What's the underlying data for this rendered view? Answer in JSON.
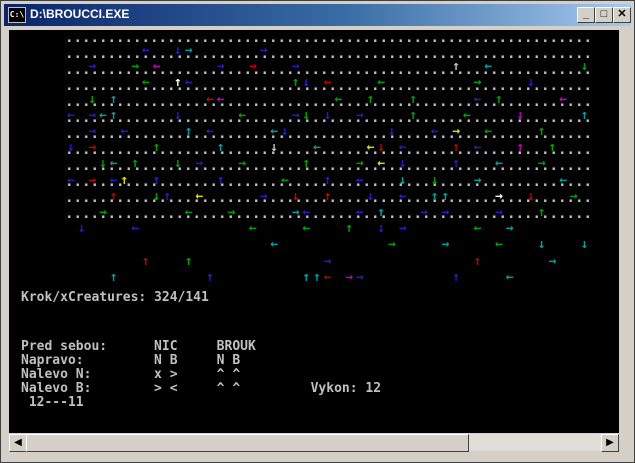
{
  "window": {
    "title": "D:\\BROUCCI.EXE",
    "icon_label": "C:\\",
    "minimize": "_",
    "maximize": "□",
    "close": "✕"
  },
  "grid_rows": [
    "..............................................................",
    "..............................................................",
    "..............................................................",
    "..............................................................",
    "..............................................................",
    "..............................................................",
    "..............................................................",
    "..............................................................",
    "..............................................................",
    "..............................................................",
    "..............................................................",
    ".............................................................."
  ],
  "arrow_palette": {
    "red": "#c00000",
    "green": "#00a000",
    "cyan": "#00a0a0",
    "blue": "#2020c0",
    "magenta": "#c000c0",
    "yellow": "#e0e000",
    "grey": "#c0c0c0",
    "white": "#ffffff"
  },
  "arrows": [
    {
      "c": 7,
      "r": 0,
      "g": "←",
      "k": "blue"
    },
    {
      "c": 10,
      "r": 0,
      "g": "↓",
      "k": "blue"
    },
    {
      "c": 11,
      "r": 0,
      "g": "→",
      "k": "cyan"
    },
    {
      "c": 18,
      "r": 0,
      "g": "→",
      "k": "blue"
    },
    {
      "c": 2,
      "r": 1,
      "g": "→",
      "k": "blue"
    },
    {
      "c": 6,
      "r": 1,
      "g": "→",
      "k": "green"
    },
    {
      "c": 8,
      "r": 1,
      "g": "←",
      "k": "magenta"
    },
    {
      "c": 14,
      "r": 1,
      "g": "→",
      "k": "blue"
    },
    {
      "c": 17,
      "r": 1,
      "g": "→",
      "k": "red"
    },
    {
      "c": 21,
      "r": 1,
      "g": "→",
      "k": "blue"
    },
    {
      "c": 36,
      "r": 1,
      "g": "↑",
      "k": "grey"
    },
    {
      "c": 39,
      "r": 1,
      "g": "←",
      "k": "cyan"
    },
    {
      "c": 48,
      "r": 1,
      "g": "↓",
      "k": "green"
    },
    {
      "c": 7,
      "r": 2,
      "g": "←",
      "k": "green"
    },
    {
      "c": 10,
      "r": 2,
      "g": "↑",
      "k": "white"
    },
    {
      "c": 11,
      "r": 2,
      "g": "←",
      "k": "blue"
    },
    {
      "c": 21,
      "r": 2,
      "g": "↑",
      "k": "green"
    },
    {
      "c": 22,
      "r": 2,
      "g": "↓",
      "k": "blue"
    },
    {
      "c": 24,
      "r": 2,
      "g": "←",
      "k": "red"
    },
    {
      "c": 29,
      "r": 2,
      "g": "←",
      "k": "green"
    },
    {
      "c": 38,
      "r": 2,
      "g": "→",
      "k": "green"
    },
    {
      "c": 43,
      "r": 2,
      "g": "↓",
      "k": "blue"
    },
    {
      "c": 2,
      "r": 3,
      "g": "↓",
      "k": "green"
    },
    {
      "c": 4,
      "r": 3,
      "g": "↑",
      "k": "cyan"
    },
    {
      "c": 13,
      "r": 3,
      "g": "←",
      "k": "red"
    },
    {
      "c": 14,
      "r": 3,
      "g": "←",
      "k": "magenta"
    },
    {
      "c": 25,
      "r": 3,
      "g": "←",
      "k": "green"
    },
    {
      "c": 28,
      "r": 3,
      "g": "↑",
      "k": "green"
    },
    {
      "c": 32,
      "r": 3,
      "g": "↑",
      "k": "green"
    },
    {
      "c": 38,
      "r": 3,
      "g": "←",
      "k": "blue"
    },
    {
      "c": 40,
      "r": 3,
      "g": "↑",
      "k": "green"
    },
    {
      "c": 46,
      "r": 3,
      "g": "←",
      "k": "magenta"
    },
    {
      "c": 0,
      "r": 4,
      "g": "←",
      "k": "blue"
    },
    {
      "c": 2,
      "r": 4,
      "g": "→",
      "k": "blue"
    },
    {
      "c": 3,
      "r": 4,
      "g": "←",
      "k": "cyan"
    },
    {
      "c": 4,
      "r": 4,
      "g": "↑",
      "k": "cyan"
    },
    {
      "c": 10,
      "r": 4,
      "g": "↓",
      "k": "blue"
    },
    {
      "c": 16,
      "r": 4,
      "g": "←",
      "k": "green"
    },
    {
      "c": 21,
      "r": 4,
      "g": "→",
      "k": "blue"
    },
    {
      "c": 22,
      "r": 4,
      "g": "↓",
      "k": "green"
    },
    {
      "c": 24,
      "r": 4,
      "g": "↓",
      "k": "blue"
    },
    {
      "c": 27,
      "r": 4,
      "g": "→",
      "k": "blue"
    },
    {
      "c": 32,
      "r": 4,
      "g": "↑",
      "k": "green"
    },
    {
      "c": 37,
      "r": 4,
      "g": "←",
      "k": "green"
    },
    {
      "c": 42,
      "r": 4,
      "g": "↓",
      "k": "magenta"
    },
    {
      "c": 48,
      "r": 4,
      "g": "↑",
      "k": "cyan"
    },
    {
      "c": 2,
      "r": 5,
      "g": "→",
      "k": "blue"
    },
    {
      "c": 5,
      "r": 5,
      "g": "←",
      "k": "blue"
    },
    {
      "c": 11,
      "r": 5,
      "g": "↑",
      "k": "cyan"
    },
    {
      "c": 13,
      "r": 5,
      "g": "←",
      "k": "blue"
    },
    {
      "c": 19,
      "r": 5,
      "g": "←",
      "k": "cyan"
    },
    {
      "c": 20,
      "r": 5,
      "g": "↓",
      "k": "blue"
    },
    {
      "c": 30,
      "r": 5,
      "g": "↓",
      "k": "blue"
    },
    {
      "c": 34,
      "r": 5,
      "g": "←",
      "k": "blue"
    },
    {
      "c": 36,
      "r": 5,
      "g": "→",
      "k": "yellow"
    },
    {
      "c": 39,
      "r": 5,
      "g": "←",
      "k": "green"
    },
    {
      "c": 44,
      "r": 5,
      "g": "↑",
      "k": "green"
    },
    {
      "c": 0,
      "r": 6,
      "g": "↓",
      "k": "blue"
    },
    {
      "c": 2,
      "r": 6,
      "g": "→",
      "k": "red"
    },
    {
      "c": 8,
      "r": 6,
      "g": "↑",
      "k": "green"
    },
    {
      "c": 14,
      "r": 6,
      "g": "↑",
      "k": "cyan"
    },
    {
      "c": 19,
      "r": 6,
      "g": "↓",
      "k": "grey"
    },
    {
      "c": 23,
      "r": 6,
      "g": "←",
      "k": "cyan"
    },
    {
      "c": 28,
      "r": 6,
      "g": "←",
      "k": "yellow"
    },
    {
      "c": 29,
      "r": 6,
      "g": "↓",
      "k": "red"
    },
    {
      "c": 31,
      "r": 6,
      "g": "←",
      "k": "blue"
    },
    {
      "c": 36,
      "r": 6,
      "g": "↑",
      "k": "red"
    },
    {
      "c": 38,
      "r": 6,
      "g": "←",
      "k": "blue"
    },
    {
      "c": 42,
      "r": 6,
      "g": "↑",
      "k": "magenta"
    },
    {
      "c": 45,
      "r": 6,
      "g": "↑",
      "k": "green"
    },
    {
      "c": 3,
      "r": 7,
      "g": "↓",
      "k": "green"
    },
    {
      "c": 4,
      "r": 7,
      "g": "←",
      "k": "cyan"
    },
    {
      "c": 6,
      "r": 7,
      "g": "↑",
      "k": "green"
    },
    {
      "c": 10,
      "r": 7,
      "g": "↓",
      "k": "green"
    },
    {
      "c": 12,
      "r": 7,
      "g": "→",
      "k": "blue"
    },
    {
      "c": 16,
      "r": 7,
      "g": "→",
      "k": "green"
    },
    {
      "c": 22,
      "r": 7,
      "g": "↑",
      "k": "green"
    },
    {
      "c": 27,
      "r": 7,
      "g": "→",
      "k": "green"
    },
    {
      "c": 29,
      "r": 7,
      "g": "←",
      "k": "yellow"
    },
    {
      "c": 31,
      "r": 7,
      "g": "↓",
      "k": "blue"
    },
    {
      "c": 36,
      "r": 7,
      "g": "↑",
      "k": "blue"
    },
    {
      "c": 40,
      "r": 7,
      "g": "←",
      "k": "cyan"
    },
    {
      "c": 44,
      "r": 7,
      "g": "→",
      "k": "green"
    },
    {
      "c": 0,
      "r": 8,
      "g": "←",
      "k": "blue"
    },
    {
      "c": 2,
      "r": 8,
      "g": "→",
      "k": "red"
    },
    {
      "c": 4,
      "r": 8,
      "g": "←",
      "k": "blue"
    },
    {
      "c": 5,
      "r": 8,
      "g": "↑",
      "k": "yellow"
    },
    {
      "c": 8,
      "r": 8,
      "g": "↑",
      "k": "blue"
    },
    {
      "c": 14,
      "r": 8,
      "g": "↑",
      "k": "blue"
    },
    {
      "c": 20,
      "r": 8,
      "g": "←",
      "k": "green"
    },
    {
      "c": 24,
      "r": 8,
      "g": "↑",
      "k": "blue"
    },
    {
      "c": 27,
      "r": 8,
      "g": "←",
      "k": "blue"
    },
    {
      "c": 31,
      "r": 8,
      "g": "↓",
      "k": "cyan"
    },
    {
      "c": 34,
      "r": 8,
      "g": "↓",
      "k": "green"
    },
    {
      "c": 38,
      "r": 8,
      "g": "→",
      "k": "cyan"
    },
    {
      "c": 46,
      "r": 8,
      "g": "←",
      "k": "cyan"
    },
    {
      "c": 4,
      "r": 9,
      "g": "↑",
      "k": "red"
    },
    {
      "c": 8,
      "r": 9,
      "g": "↓",
      "k": "green"
    },
    {
      "c": 9,
      "r": 9,
      "g": "↑",
      "k": "blue"
    },
    {
      "c": 12,
      "r": 9,
      "g": "←",
      "k": "yellow"
    },
    {
      "c": 18,
      "r": 9,
      "g": "→",
      "k": "blue"
    },
    {
      "c": 21,
      "r": 9,
      "g": "↓",
      "k": "red"
    },
    {
      "c": 24,
      "r": 9,
      "g": "↑",
      "k": "red"
    },
    {
      "c": 28,
      "r": 9,
      "g": "↓",
      "k": "blue"
    },
    {
      "c": 31,
      "r": 9,
      "g": "←",
      "k": "blue"
    },
    {
      "c": 34,
      "r": 9,
      "g": "↑",
      "k": "cyan"
    },
    {
      "c": 35,
      "r": 9,
      "g": "↑",
      "k": "cyan"
    },
    {
      "c": 40,
      "r": 9,
      "g": "→",
      "k": "white"
    },
    {
      "c": 43,
      "r": 9,
      "g": "↓",
      "k": "red"
    },
    {
      "c": 47,
      "r": 9,
      "g": "→",
      "k": "green"
    },
    {
      "c": 3,
      "r": 10,
      "g": "→",
      "k": "green"
    },
    {
      "c": 11,
      "r": 10,
      "g": "←",
      "k": "green"
    },
    {
      "c": 15,
      "r": 10,
      "g": "→",
      "k": "green"
    },
    {
      "c": 21,
      "r": 10,
      "g": "→",
      "k": "cyan"
    },
    {
      "c": 22,
      "r": 10,
      "g": "←",
      "k": "blue"
    },
    {
      "c": 27,
      "r": 10,
      "g": "←",
      "k": "blue"
    },
    {
      "c": 29,
      "r": 10,
      "g": "↑",
      "k": "cyan"
    },
    {
      "c": 33,
      "r": 10,
      "g": "→",
      "k": "blue"
    },
    {
      "c": 35,
      "r": 10,
      "g": "→",
      "k": "blue"
    },
    {
      "c": 40,
      "r": 10,
      "g": "→",
      "k": "blue"
    },
    {
      "c": 44,
      "r": 10,
      "g": "↑",
      "k": "green"
    },
    {
      "c": 1,
      "r": 11,
      "g": "↓",
      "k": "blue"
    },
    {
      "c": 6,
      "r": 11,
      "g": "←",
      "k": "blue"
    },
    {
      "c": 17,
      "r": 11,
      "g": "←",
      "k": "green"
    },
    {
      "c": 22,
      "r": 11,
      "g": "←",
      "k": "green"
    },
    {
      "c": 26,
      "r": 11,
      "g": "↑",
      "k": "green"
    },
    {
      "c": 29,
      "r": 11,
      "g": "↓",
      "k": "blue"
    },
    {
      "c": 31,
      "r": 11,
      "g": "→",
      "k": "blue"
    },
    {
      "c": 38,
      "r": 11,
      "g": "←",
      "k": "green"
    },
    {
      "c": 41,
      "r": 11,
      "g": "→",
      "k": "cyan"
    },
    {
      "c": 19,
      "r": 12,
      "g": "←",
      "k": "cyan"
    },
    {
      "c": 30,
      "r": 12,
      "g": "→",
      "k": "green"
    },
    {
      "c": 35,
      "r": 12,
      "g": "→",
      "k": "cyan"
    },
    {
      "c": 40,
      "r": 12,
      "g": "←",
      "k": "green"
    },
    {
      "c": 44,
      "r": 12,
      "g": "↓",
      "k": "cyan"
    },
    {
      "c": 48,
      "r": 12,
      "g": "↓",
      "k": "cyan"
    },
    {
      "c": 7,
      "r": 13,
      "g": "↑",
      "k": "red"
    },
    {
      "c": 11,
      "r": 13,
      "g": "↑",
      "k": "green"
    },
    {
      "c": 24,
      "r": 13,
      "g": "→",
      "k": "blue"
    },
    {
      "c": 38,
      "r": 13,
      "g": "↑",
      "k": "red"
    },
    {
      "c": 45,
      "r": 13,
      "g": "→",
      "k": "cyan"
    },
    {
      "c": 4,
      "r": 14,
      "g": "↑",
      "k": "cyan"
    },
    {
      "c": 13,
      "r": 14,
      "g": "↑",
      "k": "blue"
    },
    {
      "c": 22,
      "r": 14,
      "g": "↑",
      "k": "cyan"
    },
    {
      "c": 23,
      "r": 14,
      "g": "↑",
      "k": "cyan"
    },
    {
      "c": 24,
      "r": 14,
      "g": "←",
      "k": "red"
    },
    {
      "c": 26,
      "r": 14,
      "g": "→",
      "k": "magenta"
    },
    {
      "c": 27,
      "r": 14,
      "g": "→",
      "k": "blue"
    },
    {
      "c": 36,
      "r": 14,
      "g": "↑",
      "k": "blue"
    },
    {
      "c": 41,
      "r": 14,
      "g": "←",
      "k": "cyan"
    }
  ],
  "lines": [
    {
      "id": "krok-line",
      "text": "Krok/xCreatures: 324/141"
    },
    {
      "id": "pred-sebou-line",
      "text": "Pred sebou:      NIC     BROUK"
    },
    {
      "id": "napravo-line",
      "text": "Napravo:         N B     N B"
    },
    {
      "id": "nalevo-n-line",
      "text": "Nalevo N:        x >     ^ ^"
    },
    {
      "id": "nalevo-b-line",
      "text": "Nalevo B:        > <     ^ ^         Vykon: 12"
    },
    {
      "id": "counter-line",
      "text": " 12---11"
    }
  ],
  "scrollbar": {
    "left": "◀",
    "right": "▶"
  }
}
